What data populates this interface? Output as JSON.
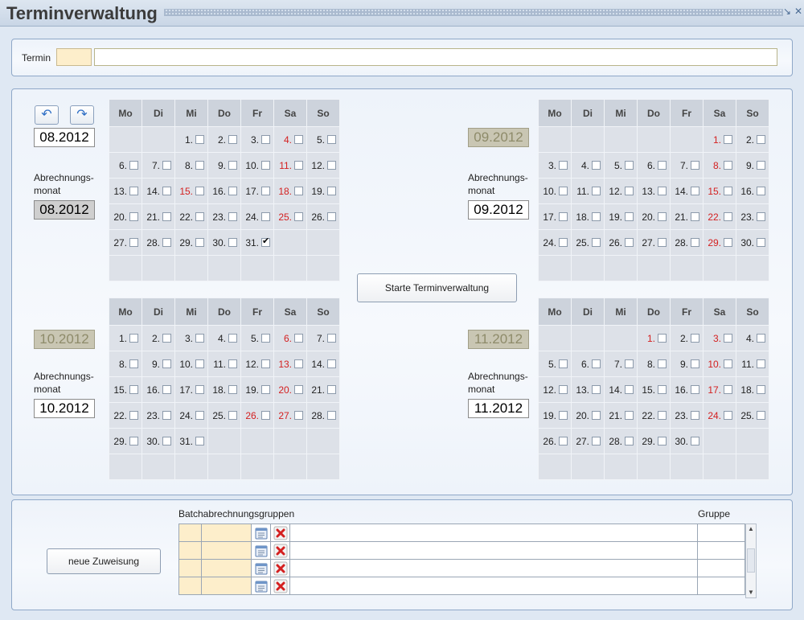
{
  "window": {
    "title": "Terminverwaltung",
    "minimize": "↘",
    "close": "✕"
  },
  "termin": {
    "label": "Termin",
    "code": "",
    "value": ""
  },
  "nav": {
    "back_icon": "undo-arrow-icon",
    "forward_icon": "redo-arrow-icon"
  },
  "calendars": {
    "weekdays": [
      "Mo",
      "Di",
      "Mi",
      "Do",
      "Fr",
      "Sa",
      "So"
    ],
    "abrechnungs_label": "Abrechnungs-monat",
    "c1": {
      "month_display": "08.2012",
      "abrechnungsmonat": "08.2012",
      "weeks": [
        [
          null,
          null,
          {
            "d": "1."
          },
          {
            "d": "2."
          },
          {
            "d": "3."
          },
          {
            "d": "4.",
            "red": true
          },
          {
            "d": "5."
          }
        ],
        [
          {
            "d": "6."
          },
          {
            "d": "7."
          },
          {
            "d": "8."
          },
          {
            "d": "9."
          },
          {
            "d": "10."
          },
          {
            "d": "11.",
            "red": true
          },
          {
            "d": "12."
          }
        ],
        [
          {
            "d": "13."
          },
          {
            "d": "14."
          },
          {
            "d": "15.",
            "red": true
          },
          {
            "d": "16."
          },
          {
            "d": "17."
          },
          {
            "d": "18.",
            "red": true
          },
          {
            "d": "19."
          }
        ],
        [
          {
            "d": "20."
          },
          {
            "d": "21."
          },
          {
            "d": "22."
          },
          {
            "d": "23."
          },
          {
            "d": "24."
          },
          {
            "d": "25.",
            "red": true
          },
          {
            "d": "26."
          }
        ],
        [
          {
            "d": "27."
          },
          {
            "d": "28."
          },
          {
            "d": "29."
          },
          {
            "d": "30."
          },
          {
            "d": "31.",
            "checked": true
          },
          null,
          null
        ],
        [
          null,
          null,
          null,
          null,
          null,
          null,
          null
        ]
      ]
    },
    "c2": {
      "month_display": "09.2012",
      "abrechnungsmonat": "09.2012",
      "weeks": [
        [
          null,
          null,
          null,
          null,
          null,
          {
            "d": "1.",
            "red": true
          },
          {
            "d": "2."
          }
        ],
        [
          {
            "d": "3."
          },
          {
            "d": "4."
          },
          {
            "d": "5."
          },
          {
            "d": "6."
          },
          {
            "d": "7."
          },
          {
            "d": "8.",
            "red": true
          },
          {
            "d": "9."
          }
        ],
        [
          {
            "d": "10."
          },
          {
            "d": "11."
          },
          {
            "d": "12."
          },
          {
            "d": "13."
          },
          {
            "d": "14."
          },
          {
            "d": "15.",
            "red": true
          },
          {
            "d": "16."
          }
        ],
        [
          {
            "d": "17."
          },
          {
            "d": "18."
          },
          {
            "d": "19."
          },
          {
            "d": "20."
          },
          {
            "d": "21."
          },
          {
            "d": "22.",
            "red": true
          },
          {
            "d": "23."
          }
        ],
        [
          {
            "d": "24."
          },
          {
            "d": "25."
          },
          {
            "d": "26."
          },
          {
            "d": "27."
          },
          {
            "d": "28."
          },
          {
            "d": "29.",
            "red": true
          },
          {
            "d": "30."
          }
        ],
        [
          null,
          null,
          null,
          null,
          null,
          null,
          null
        ]
      ]
    },
    "c3": {
      "month_display": "10.2012",
      "abrechnungsmonat": "10.2012",
      "weeks": [
        [
          {
            "d": "1."
          },
          {
            "d": "2."
          },
          {
            "d": "3."
          },
          {
            "d": "4."
          },
          {
            "d": "5."
          },
          {
            "d": "6.",
            "red": true
          },
          {
            "d": "7."
          }
        ],
        [
          {
            "d": "8."
          },
          {
            "d": "9."
          },
          {
            "d": "10."
          },
          {
            "d": "11."
          },
          {
            "d": "12."
          },
          {
            "d": "13.",
            "red": true
          },
          {
            "d": "14."
          }
        ],
        [
          {
            "d": "15."
          },
          {
            "d": "16."
          },
          {
            "d": "17."
          },
          {
            "d": "18."
          },
          {
            "d": "19."
          },
          {
            "d": "20.",
            "red": true
          },
          {
            "d": "21."
          }
        ],
        [
          {
            "d": "22."
          },
          {
            "d": "23."
          },
          {
            "d": "24."
          },
          {
            "d": "25."
          },
          {
            "d": "26.",
            "red": true
          },
          {
            "d": "27.",
            "red": true
          },
          {
            "d": "28."
          }
        ],
        [
          {
            "d": "29."
          },
          {
            "d": "30."
          },
          {
            "d": "31."
          },
          null,
          null,
          null,
          null
        ],
        [
          null,
          null,
          null,
          null,
          null,
          null,
          null
        ]
      ]
    },
    "c4": {
      "month_display": "11.2012",
      "abrechnungsmonat": "11.2012",
      "weeks": [
        [
          null,
          null,
          null,
          {
            "d": "1.",
            "red": true
          },
          {
            "d": "2."
          },
          {
            "d": "3.",
            "red": true
          },
          {
            "d": "4."
          }
        ],
        [
          {
            "d": "5."
          },
          {
            "d": "6."
          },
          {
            "d": "7."
          },
          {
            "d": "8."
          },
          {
            "d": "9."
          },
          {
            "d": "10.",
            "red": true
          },
          {
            "d": "11."
          }
        ],
        [
          {
            "d": "12."
          },
          {
            "d": "13."
          },
          {
            "d": "14."
          },
          {
            "d": "15."
          },
          {
            "d": "16."
          },
          {
            "d": "17.",
            "red": true
          },
          {
            "d": "18."
          }
        ],
        [
          {
            "d": "19."
          },
          {
            "d": "20."
          },
          {
            "d": "21."
          },
          {
            "d": "22."
          },
          {
            "d": "23."
          },
          {
            "d": "24.",
            "red": true
          },
          {
            "d": "25."
          }
        ],
        [
          {
            "d": "26."
          },
          {
            "d": "27."
          },
          {
            "d": "28."
          },
          {
            "d": "29."
          },
          {
            "d": "30."
          },
          null,
          null
        ],
        [
          null,
          null,
          null,
          null,
          null,
          null,
          null
        ]
      ]
    }
  },
  "start_button": "Starte Terminverwaltung",
  "batch": {
    "header": "Batchabrechnungsgruppen",
    "gruppe_header": "Gruppe",
    "new_button": "neue Zuweisung",
    "rows": 4,
    "edit_icon": "calendar-edit-icon",
    "delete_icon": "red-x-delete-icon"
  },
  "colors": {
    "red_day": "#d42020",
    "panel_border": "#8fa8c8",
    "yellow_cell": "#fdeecb"
  }
}
